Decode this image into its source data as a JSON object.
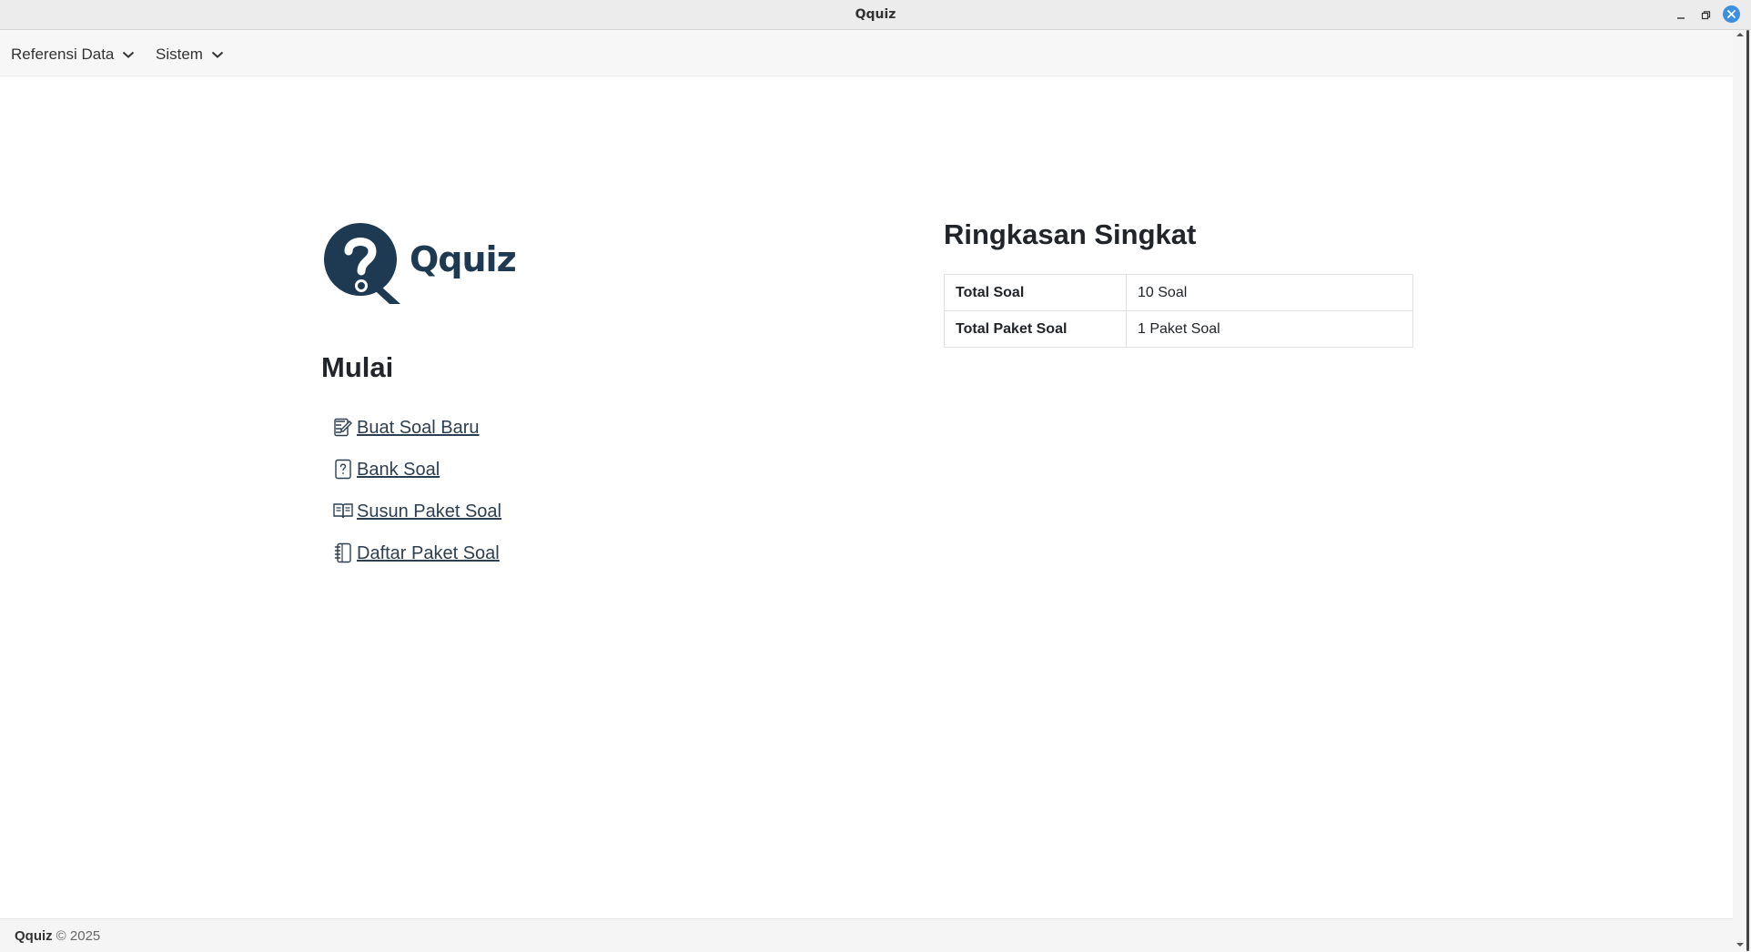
{
  "window": {
    "title": "Qquiz"
  },
  "menu": [
    {
      "label": "Referensi Data"
    },
    {
      "label": "Sistem"
    }
  ],
  "logo": {
    "text": "Qquiz"
  },
  "start": {
    "heading": "Mulai",
    "links": [
      {
        "label": "Buat Soal Baru",
        "icon": "edit-note-icon"
      },
      {
        "label": "Bank Soal",
        "icon": "question-file-icon"
      },
      {
        "label": "Susun Paket Soal",
        "icon": "open-book-icon"
      },
      {
        "label": "Daftar Paket Soal",
        "icon": "notebook-icon"
      }
    ]
  },
  "summary": {
    "heading": "Ringkasan Singkat",
    "rows": [
      {
        "label": "Total Soal",
        "value": "10 Soal"
      },
      {
        "label": "Total Paket Soal",
        "value": "1 Paket Soal"
      }
    ]
  },
  "footer": {
    "brand": "Qquiz",
    "copyright": "© 2025"
  },
  "colors": {
    "brand": "#1e3a52",
    "link": "#2c3e50",
    "close_button": "#3d8fe0"
  }
}
